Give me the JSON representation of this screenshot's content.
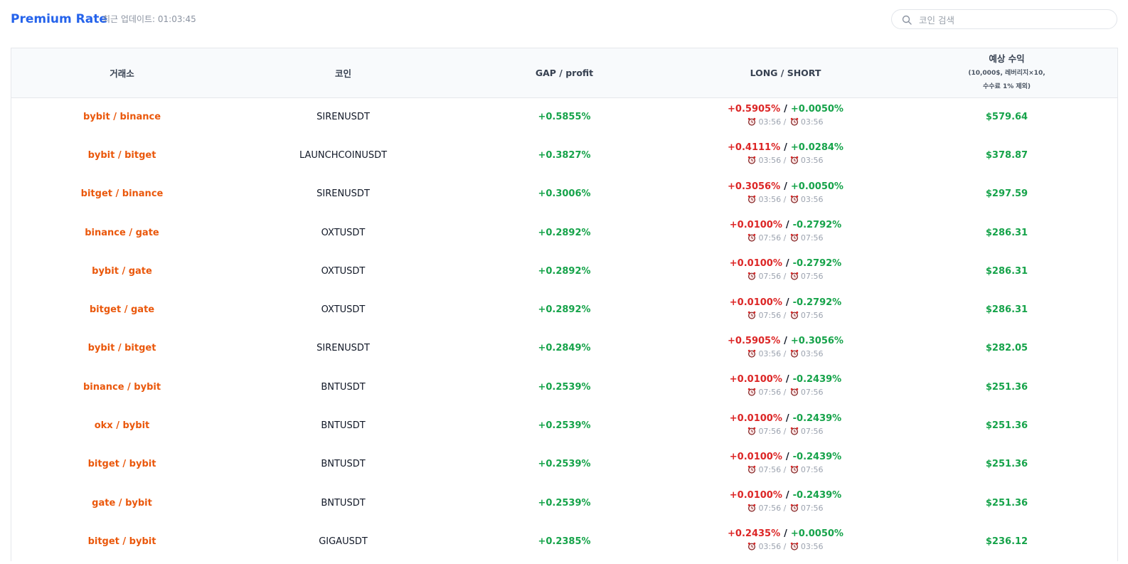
{
  "header": {
    "title": "Premium Rate",
    "updated": "최근 업데이트: 01:03:45",
    "search_placeholder": "코인 검색"
  },
  "columns": {
    "exchange": "거래소",
    "coin": "코인",
    "gap": "GAP / profit",
    "ls": "LONG / SHORT",
    "profit": "예상 수익",
    "profit_sub1": "(10,000$, 레버리지×10,",
    "profit_sub2": "수수료 1% 제외)"
  },
  "rows": [
    {
      "exchange": "bybit / binance",
      "coin": "SIRENUSDT",
      "gap": "+0.5855%",
      "long": "+0.5905%",
      "short": "+0.0050%",
      "t1": "03:56",
      "t2": "03:56",
      "profit": "$579.64"
    },
    {
      "exchange": "bybit / bitget",
      "coin": "LAUNCHCOINUSDT",
      "gap": "+0.3827%",
      "long": "+0.4111%",
      "short": "+0.0284%",
      "t1": "03:56",
      "t2": "03:56",
      "profit": "$378.87"
    },
    {
      "exchange": "bitget / binance",
      "coin": "SIRENUSDT",
      "gap": "+0.3006%",
      "long": "+0.3056%",
      "short": "+0.0050%",
      "t1": "03:56",
      "t2": "03:56",
      "profit": "$297.59"
    },
    {
      "exchange": "binance / gate",
      "coin": "OXTUSDT",
      "gap": "+0.2892%",
      "long": "+0.0100%",
      "short": "-0.2792%",
      "t1": "07:56",
      "t2": "07:56",
      "profit": "$286.31"
    },
    {
      "exchange": "bybit / gate",
      "coin": "OXTUSDT",
      "gap": "+0.2892%",
      "long": "+0.0100%",
      "short": "-0.2792%",
      "t1": "07:56",
      "t2": "07:56",
      "profit": "$286.31"
    },
    {
      "exchange": "bitget / gate",
      "coin": "OXTUSDT",
      "gap": "+0.2892%",
      "long": "+0.0100%",
      "short": "-0.2792%",
      "t1": "07:56",
      "t2": "07:56",
      "profit": "$286.31"
    },
    {
      "exchange": "bybit / bitget",
      "coin": "SIRENUSDT",
      "gap": "+0.2849%",
      "long": "+0.5905%",
      "short": "+0.3056%",
      "t1": "03:56",
      "t2": "03:56",
      "profit": "$282.05"
    },
    {
      "exchange": "binance / bybit",
      "coin": "BNTUSDT",
      "gap": "+0.2539%",
      "long": "+0.0100%",
      "short": "-0.2439%",
      "t1": "07:56",
      "t2": "07:56",
      "profit": "$251.36"
    },
    {
      "exchange": "okx / bybit",
      "coin": "BNTUSDT",
      "gap": "+0.2539%",
      "long": "+0.0100%",
      "short": "-0.2439%",
      "t1": "07:56",
      "t2": "07:56",
      "profit": "$251.36"
    },
    {
      "exchange": "bitget / bybit",
      "coin": "BNTUSDT",
      "gap": "+0.2539%",
      "long": "+0.0100%",
      "short": "-0.2439%",
      "t1": "07:56",
      "t2": "07:56",
      "profit": "$251.36"
    },
    {
      "exchange": "gate / bybit",
      "coin": "BNTUSDT",
      "gap": "+0.2539%",
      "long": "+0.0100%",
      "short": "-0.2439%",
      "t1": "07:56",
      "t2": "07:56",
      "profit": "$251.36"
    },
    {
      "exchange": "bitget / bybit",
      "coin": "GIGAUSDT",
      "gap": "+0.2385%",
      "long": "+0.2435%",
      "short": "+0.0050%",
      "t1": "03:56",
      "t2": "03:56",
      "profit": "$236.12"
    }
  ],
  "icons": {
    "search": "search-icon",
    "clock": "alarm-clock-icon"
  },
  "colors": {
    "title": "#2563eb",
    "exchange": "#ea580c",
    "positive": "#16a34a",
    "long": "#dc2626"
  }
}
